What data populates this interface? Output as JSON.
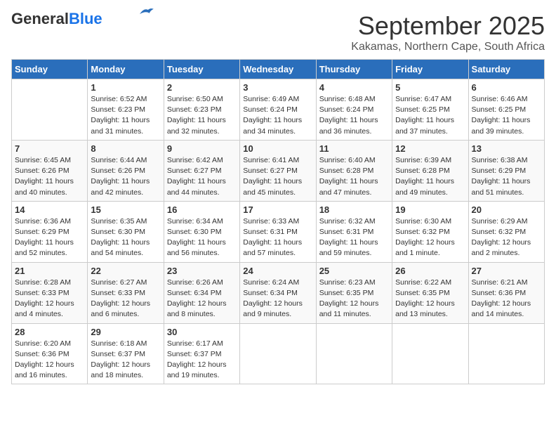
{
  "logo": {
    "general": "General",
    "blue": "Blue"
  },
  "title": "September 2025",
  "subtitle": "Kakamas, Northern Cape, South Africa",
  "weekdays": [
    "Sunday",
    "Monday",
    "Tuesday",
    "Wednesday",
    "Thursday",
    "Friday",
    "Saturday"
  ],
  "weeks": [
    [
      {
        "day": "",
        "text": ""
      },
      {
        "day": "1",
        "text": "Sunrise: 6:52 AM\nSunset: 6:23 PM\nDaylight: 11 hours\nand 31 minutes."
      },
      {
        "day": "2",
        "text": "Sunrise: 6:50 AM\nSunset: 6:23 PM\nDaylight: 11 hours\nand 32 minutes."
      },
      {
        "day": "3",
        "text": "Sunrise: 6:49 AM\nSunset: 6:24 PM\nDaylight: 11 hours\nand 34 minutes."
      },
      {
        "day": "4",
        "text": "Sunrise: 6:48 AM\nSunset: 6:24 PM\nDaylight: 11 hours\nand 36 minutes."
      },
      {
        "day": "5",
        "text": "Sunrise: 6:47 AM\nSunset: 6:25 PM\nDaylight: 11 hours\nand 37 minutes."
      },
      {
        "day": "6",
        "text": "Sunrise: 6:46 AM\nSunset: 6:25 PM\nDaylight: 11 hours\nand 39 minutes."
      }
    ],
    [
      {
        "day": "7",
        "text": "Sunrise: 6:45 AM\nSunset: 6:26 PM\nDaylight: 11 hours\nand 40 minutes."
      },
      {
        "day": "8",
        "text": "Sunrise: 6:44 AM\nSunset: 6:26 PM\nDaylight: 11 hours\nand 42 minutes."
      },
      {
        "day": "9",
        "text": "Sunrise: 6:42 AM\nSunset: 6:27 PM\nDaylight: 11 hours\nand 44 minutes."
      },
      {
        "day": "10",
        "text": "Sunrise: 6:41 AM\nSunset: 6:27 PM\nDaylight: 11 hours\nand 45 minutes."
      },
      {
        "day": "11",
        "text": "Sunrise: 6:40 AM\nSunset: 6:28 PM\nDaylight: 11 hours\nand 47 minutes."
      },
      {
        "day": "12",
        "text": "Sunrise: 6:39 AM\nSunset: 6:28 PM\nDaylight: 11 hours\nand 49 minutes."
      },
      {
        "day": "13",
        "text": "Sunrise: 6:38 AM\nSunset: 6:29 PM\nDaylight: 11 hours\nand 51 minutes."
      }
    ],
    [
      {
        "day": "14",
        "text": "Sunrise: 6:36 AM\nSunset: 6:29 PM\nDaylight: 11 hours\nand 52 minutes."
      },
      {
        "day": "15",
        "text": "Sunrise: 6:35 AM\nSunset: 6:30 PM\nDaylight: 11 hours\nand 54 minutes."
      },
      {
        "day": "16",
        "text": "Sunrise: 6:34 AM\nSunset: 6:30 PM\nDaylight: 11 hours\nand 56 minutes."
      },
      {
        "day": "17",
        "text": "Sunrise: 6:33 AM\nSunset: 6:31 PM\nDaylight: 11 hours\nand 57 minutes."
      },
      {
        "day": "18",
        "text": "Sunrise: 6:32 AM\nSunset: 6:31 PM\nDaylight: 11 hours\nand 59 minutes."
      },
      {
        "day": "19",
        "text": "Sunrise: 6:30 AM\nSunset: 6:32 PM\nDaylight: 12 hours\nand 1 minute."
      },
      {
        "day": "20",
        "text": "Sunrise: 6:29 AM\nSunset: 6:32 PM\nDaylight: 12 hours\nand 2 minutes."
      }
    ],
    [
      {
        "day": "21",
        "text": "Sunrise: 6:28 AM\nSunset: 6:33 PM\nDaylight: 12 hours\nand 4 minutes."
      },
      {
        "day": "22",
        "text": "Sunrise: 6:27 AM\nSunset: 6:33 PM\nDaylight: 12 hours\nand 6 minutes."
      },
      {
        "day": "23",
        "text": "Sunrise: 6:26 AM\nSunset: 6:34 PM\nDaylight: 12 hours\nand 8 minutes."
      },
      {
        "day": "24",
        "text": "Sunrise: 6:24 AM\nSunset: 6:34 PM\nDaylight: 12 hours\nand 9 minutes."
      },
      {
        "day": "25",
        "text": "Sunrise: 6:23 AM\nSunset: 6:35 PM\nDaylight: 12 hours\nand 11 minutes."
      },
      {
        "day": "26",
        "text": "Sunrise: 6:22 AM\nSunset: 6:35 PM\nDaylight: 12 hours\nand 13 minutes."
      },
      {
        "day": "27",
        "text": "Sunrise: 6:21 AM\nSunset: 6:36 PM\nDaylight: 12 hours\nand 14 minutes."
      }
    ],
    [
      {
        "day": "28",
        "text": "Sunrise: 6:20 AM\nSunset: 6:36 PM\nDaylight: 12 hours\nand 16 minutes."
      },
      {
        "day": "29",
        "text": "Sunrise: 6:18 AM\nSunset: 6:37 PM\nDaylight: 12 hours\nand 18 minutes."
      },
      {
        "day": "30",
        "text": "Sunrise: 6:17 AM\nSunset: 6:37 PM\nDaylight: 12 hours\nand 19 minutes."
      },
      {
        "day": "",
        "text": ""
      },
      {
        "day": "",
        "text": ""
      },
      {
        "day": "",
        "text": ""
      },
      {
        "day": "",
        "text": ""
      }
    ]
  ]
}
